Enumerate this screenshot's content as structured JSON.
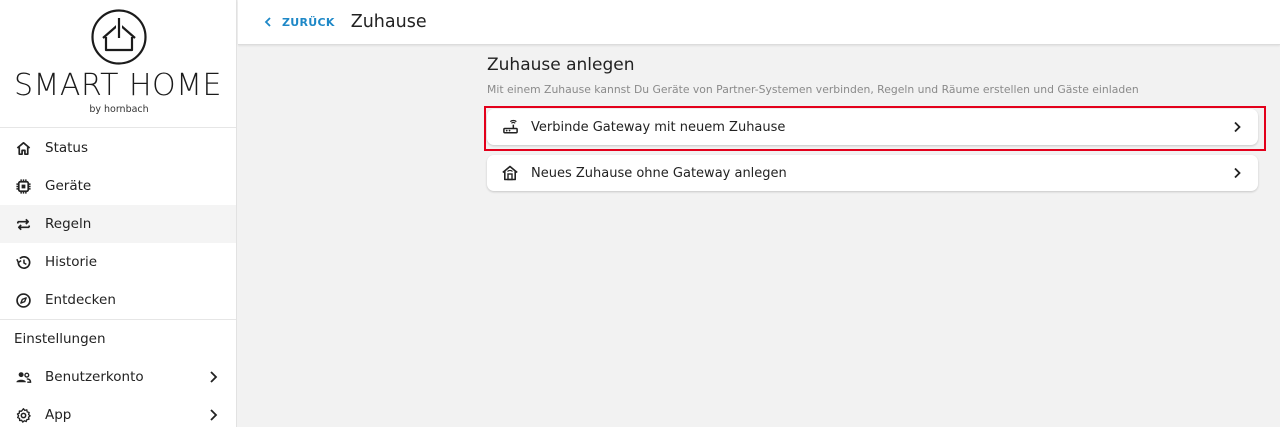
{
  "brand": {
    "name": "SMART HOME",
    "sub": "by hornbach"
  },
  "nav": {
    "items": [
      {
        "label": "Status",
        "icon": "home-icon"
      },
      {
        "label": "Geräte",
        "icon": "chip-icon"
      },
      {
        "label": "Regeln",
        "icon": "swap-icon"
      },
      {
        "label": "Historie",
        "icon": "history-icon"
      },
      {
        "label": "Entdecken",
        "icon": "compass-icon"
      }
    ],
    "active": "Regeln"
  },
  "settings": {
    "title": "Einstellungen",
    "items": [
      {
        "label": "Benutzerkonto",
        "icon": "users-icon"
      },
      {
        "label": "App",
        "icon": "gear-icon"
      }
    ]
  },
  "header": {
    "back_label": "ZURÜCK",
    "title": "Zuhause"
  },
  "main": {
    "heading": "Zuhause anlegen",
    "description": "Mit einem Zuhause kannst Du Geräte von Partner-Systemen verbinden, Regeln und Räume erstellen und Gäste einladen",
    "options": [
      {
        "label": "Verbinde Gateway mit neuem Zuhause",
        "icon": "router-icon",
        "highlighted": true
      },
      {
        "label": "Neues Zuhause ohne Gateway anlegen",
        "icon": "house-icon",
        "highlighted": false
      }
    ]
  },
  "colors": {
    "accent": "#1e88c7",
    "highlight": "#e3001b",
    "background": "#f2f2f2"
  }
}
